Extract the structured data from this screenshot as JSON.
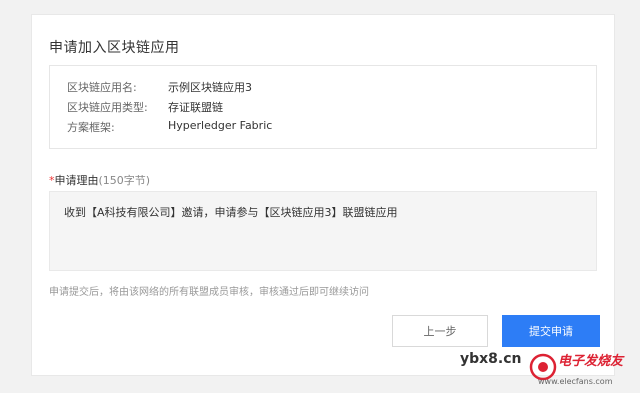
{
  "page": {
    "title": "申请加入区块链应用"
  },
  "info": {
    "rows": [
      {
        "label": "区块链应用名:",
        "value": "示例区块链应用3"
      },
      {
        "label": "区块链应用类型:",
        "value": "存证联盟链"
      },
      {
        "label": "方案框架:",
        "value": "Hyperledger Fabric"
      }
    ]
  },
  "reason": {
    "required_mark": "*",
    "label": "申请理由",
    "hint": "(150字节)",
    "text": "收到【A科技有限公司】邀请，申请参与【区块链应用3】联盟链应用"
  },
  "note": "申请提交后，将由该网络的所有联盟成员审核，审核通过后即可继续访问",
  "buttons": {
    "prev": "上一步",
    "submit": "提交申请"
  },
  "watermark": {
    "site": "ybx8.cn",
    "brand": "电子发烧友",
    "url": "www.elecfans.com"
  },
  "colors": {
    "accent": "#2d7df6",
    "required": "#ee3333"
  }
}
